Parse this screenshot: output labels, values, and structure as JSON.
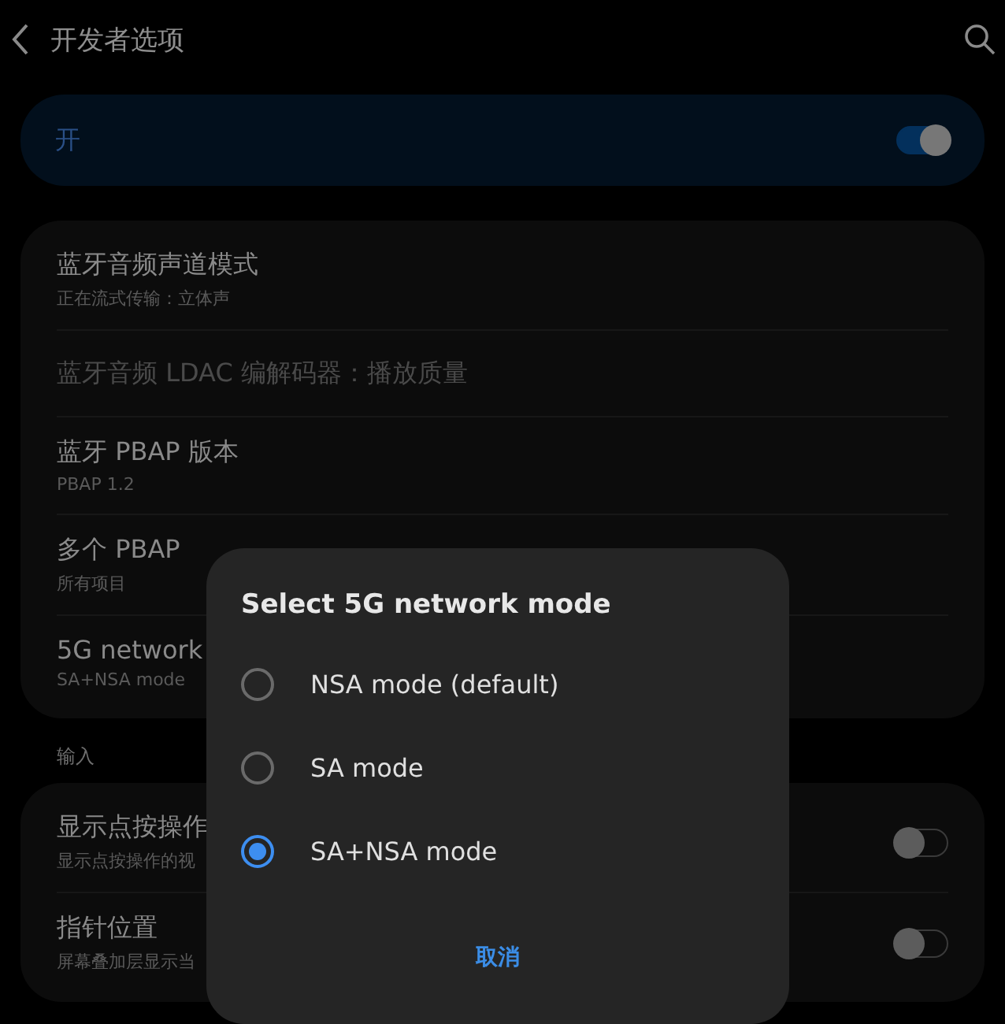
{
  "header": {
    "title": "开发者选项"
  },
  "master_switch": {
    "label": "开",
    "on": true
  },
  "settings_groups": [
    {
      "items": [
        {
          "title": "蓝牙音频声道模式",
          "subtitle": "正在流式传输：立体声",
          "disabled": false
        },
        {
          "title": "蓝牙音频 LDAC 编解码器：播放质量",
          "disabled": true
        },
        {
          "title": "蓝牙 PBAP 版本",
          "subtitle": "PBAP 1.2",
          "disabled": false
        },
        {
          "title": "多个 PBAP",
          "subtitle": "所有项目",
          "disabled": false
        },
        {
          "title": "5G network",
          "subtitle": "SA+NSA mode",
          "disabled": false
        }
      ]
    },
    {
      "label": "输入",
      "items": [
        {
          "title": "显示点按操作",
          "subtitle": "显示点按操作的视",
          "disabled": false,
          "toggle": {
            "on": false
          }
        },
        {
          "title": "指针位置",
          "subtitle": "屏幕叠加层显示当",
          "disabled": false,
          "toggle": {
            "on": false
          }
        }
      ]
    }
  ],
  "dialog": {
    "title": "Select 5G network mode",
    "options": [
      {
        "label": "NSA mode (default)",
        "selected": false
      },
      {
        "label": "SA mode",
        "selected": false
      },
      {
        "label": "SA+NSA mode",
        "selected": true
      }
    ],
    "cancel_button": "取消"
  }
}
